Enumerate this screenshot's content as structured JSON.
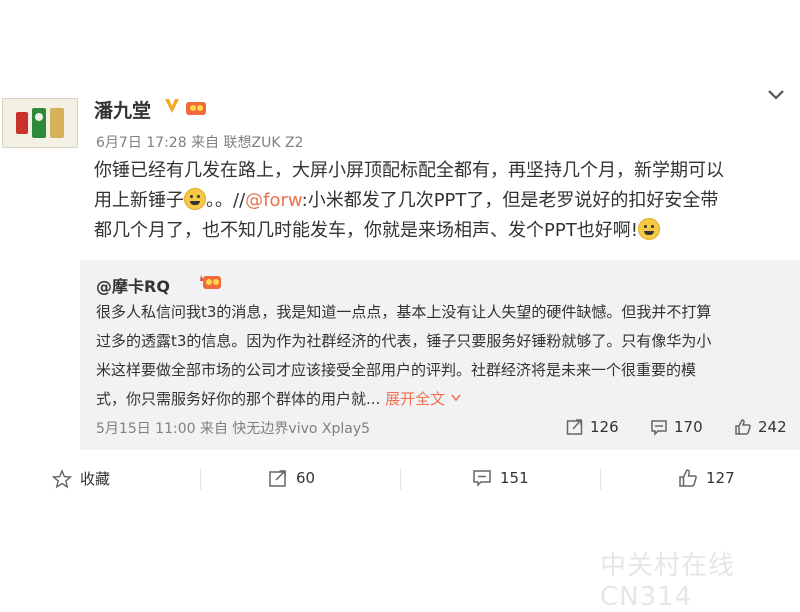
{
  "post": {
    "author": "潘九堂",
    "meta": "6月7日 17:28 来自 联想ZUK Z2",
    "body_line1": "你锤已经有几发在路上，大屏小屏顶配标配全都有，再坚持几个月，新学期可以",
    "body_line2_pre": "用上新锤子",
    "body_line2_mid": "。。//",
    "body_line2_link": "@forw",
    "body_line2_post": ":小米都发了几次PPT了，但是老罗说好的扣好安全带",
    "body_line3": "都几个月了，也不知几时能发车，你就是来场相声、发个PPT也好啊!"
  },
  "repost": {
    "author": "@摩卡RQ",
    "line1": "很多人私信问我t3的消息，我是知道一点点，基本上没有让人失望的硬件缺憾。但我并不打算",
    "line2": "过多的透露t3的信息。因为作为社群经济的代表，锤子只要服务好锤粉就够了。只有像华为小",
    "line3": "米这样要做全部市场的公司才应该接受全部用户的评判。社群经济将是未来一个很重要的模",
    "line4": "式，你只需服务好你的那个群体的用户就...",
    "expand": "展开全文",
    "meta": "5月15日 11:00 来自 快无边界vivo Xplay5",
    "reposts": "126",
    "comments": "170",
    "likes": "242"
  },
  "actions": {
    "favorite": "收藏",
    "repost": "60",
    "comment": "151",
    "like": "127"
  },
  "watermark": "中关村在线 CN314",
  "colors": {
    "link": "#eb7350",
    "repost_bg": "#f2f2f5",
    "badge": "#f6a623"
  }
}
